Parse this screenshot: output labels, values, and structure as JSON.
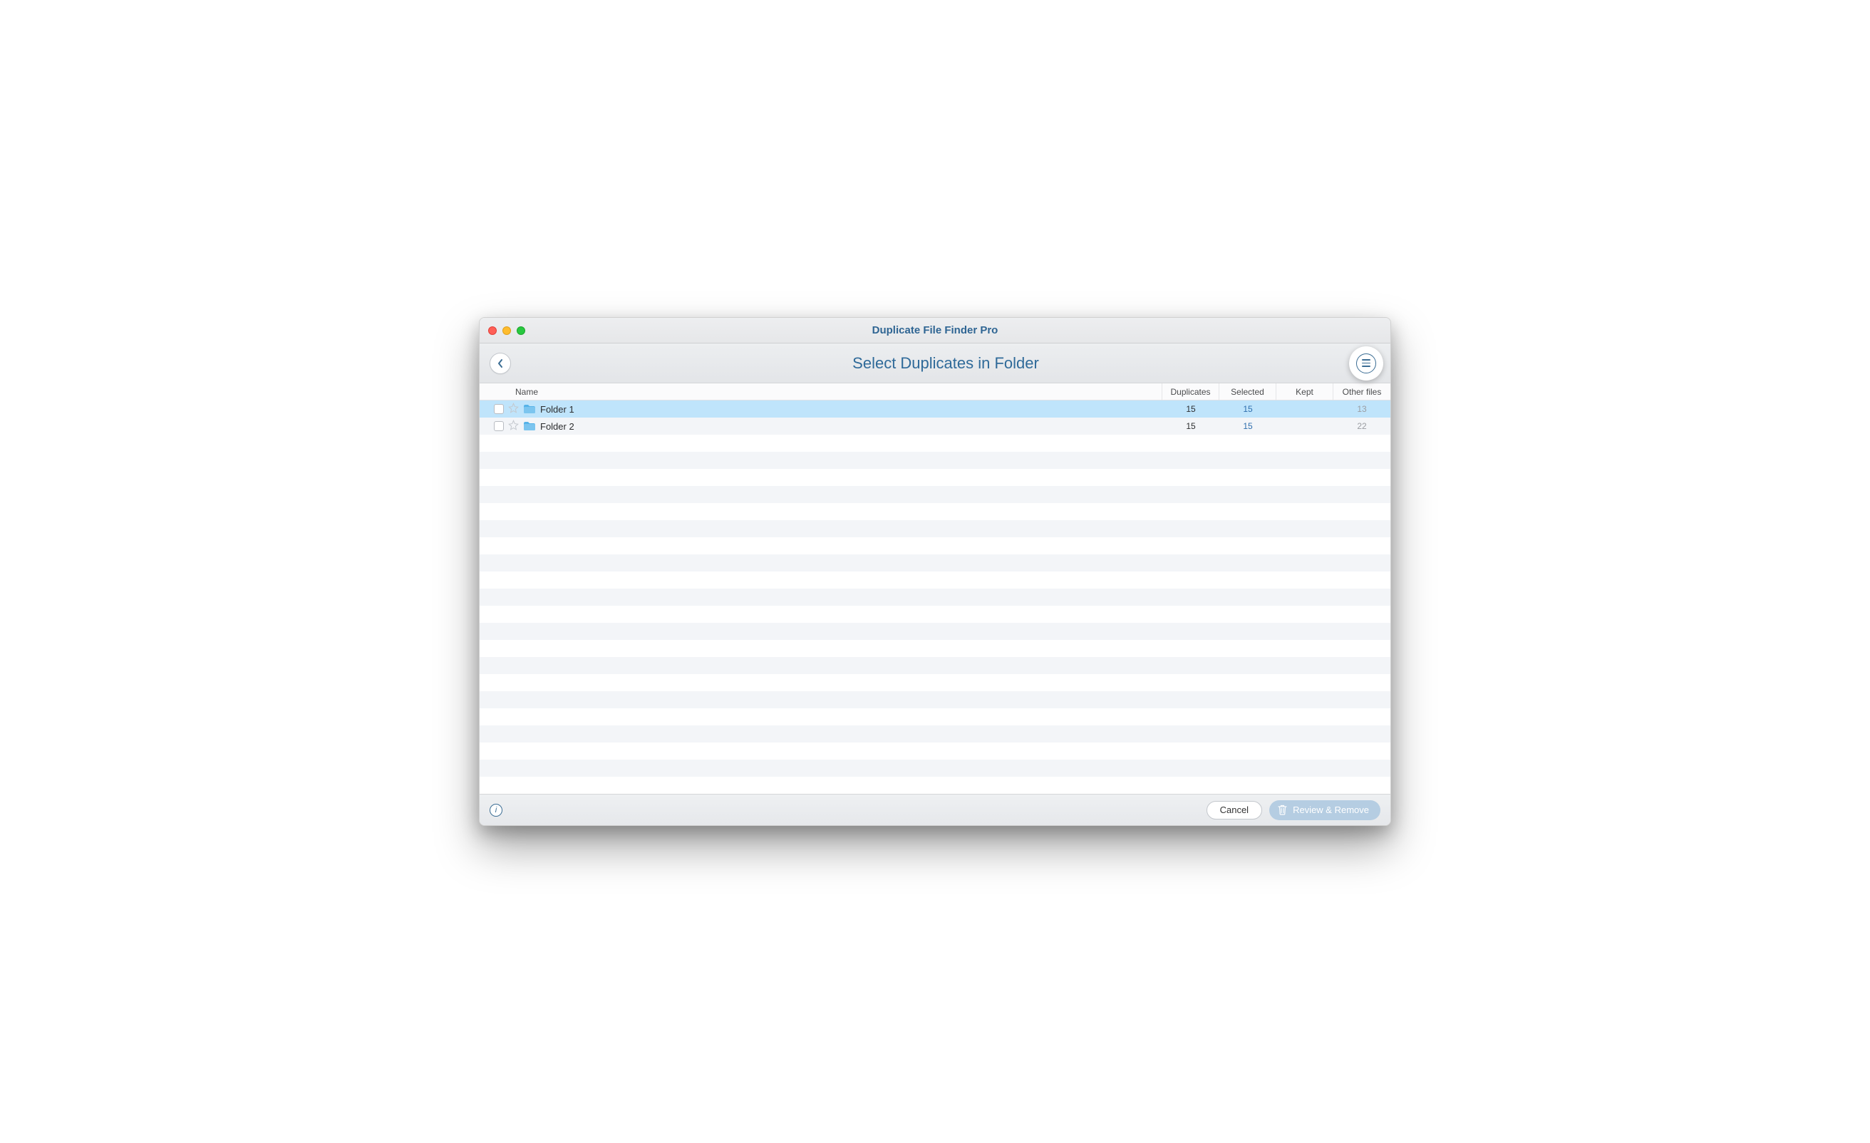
{
  "app_title": "Duplicate File Finder Pro",
  "subheader": "Select Duplicates in Folder",
  "columns": {
    "name": "Name",
    "duplicates": "Duplicates",
    "selected": "Selected",
    "kept": "Kept",
    "other": "Other files"
  },
  "rows": [
    {
      "name": "Folder 1",
      "duplicates": "15",
      "selected": "15",
      "kept": "",
      "other": "13"
    },
    {
      "name": "Folder 2",
      "duplicates": "15",
      "selected": "15",
      "kept": "",
      "other": "22"
    }
  ],
  "footer": {
    "cancel": "Cancel",
    "review": "Review & Remove"
  }
}
